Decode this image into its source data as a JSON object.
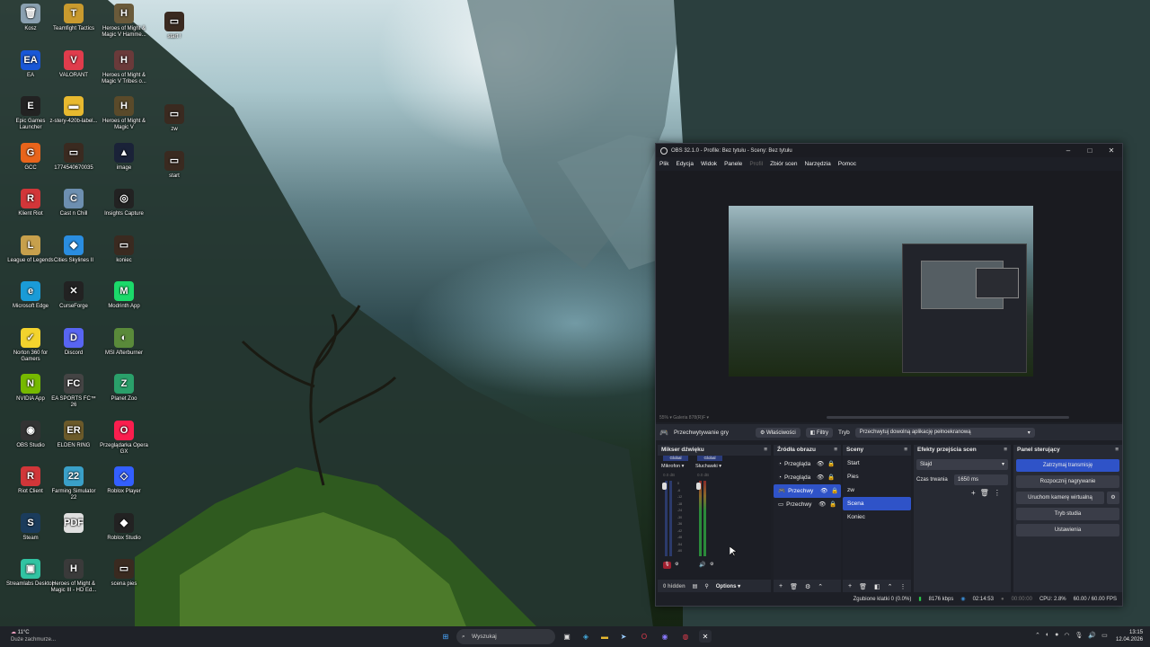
{
  "desktop_icons": [
    {
      "label": "Kosz",
      "icon": "recycle-bin-icon",
      "color": "#8aa0b0",
      "glyph": "🗑"
    },
    {
      "label": "EA",
      "icon": "ea-icon",
      "color": "#1957d6",
      "glyph": "EA"
    },
    {
      "label": "Epic Games Launcher",
      "icon": "epic-games-icon",
      "color": "#222",
      "glyph": "E"
    },
    {
      "label": "GCC",
      "icon": "gcc-icon",
      "color": "#e8641b",
      "glyph": "G"
    },
    {
      "label": "Klient Riot",
      "icon": "riot-icon",
      "color": "#d13639",
      "glyph": "R"
    },
    {
      "label": "League of Legends",
      "icon": "league-icon",
      "color": "#c7a04c",
      "glyph": "L"
    },
    {
      "label": "Microsoft Edge",
      "icon": "edge-icon",
      "color": "#1a9bd7",
      "glyph": "e"
    },
    {
      "label": "Norton 360 for Gamers",
      "icon": "norton-icon",
      "color": "#f3d32d",
      "glyph": "✓"
    },
    {
      "label": "NVIDIA App",
      "icon": "nvidia-icon",
      "color": "#76b900",
      "glyph": "N"
    },
    {
      "label": "OBS Studio",
      "icon": "obs-icon",
      "color": "#333",
      "glyph": "◉"
    },
    {
      "label": "Riot Client",
      "icon": "riot-client-icon",
      "color": "#d13639",
      "glyph": "R"
    },
    {
      "label": "Steam",
      "icon": "steam-icon",
      "color": "#1b3c5c",
      "glyph": "S"
    },
    {
      "label": "Streamlabs Desktop",
      "icon": "streamlabs-icon",
      "color": "#31c3a2",
      "glyph": "▣"
    },
    {
      "label": "Teamfight Tactics",
      "icon": "tft-icon",
      "color": "#c99a2e",
      "glyph": "T"
    },
    {
      "label": "VALORANT",
      "icon": "valorant-icon",
      "color": "#e03c4c",
      "glyph": "V"
    },
    {
      "label": "z-stery-420b-label...",
      "icon": "folder-icon",
      "color": "#e8b92f",
      "glyph": "▬"
    },
    {
      "label": "1774540670035",
      "icon": "video-file-icon",
      "color": "#3a2a20",
      "glyph": "▭"
    },
    {
      "label": "Cast n Chill",
      "icon": "cast-n-chill-icon",
      "color": "#6d8fb0",
      "glyph": "C"
    },
    {
      "label": "Cities Skylines II",
      "icon": "cities-icon",
      "color": "#2a8de0",
      "glyph": "◆"
    },
    {
      "label": "CurseForge",
      "icon": "curseforge-icon",
      "color": "#222",
      "glyph": "✕"
    },
    {
      "label": "Discord",
      "icon": "discord-icon",
      "color": "#5865f2",
      "glyph": "D"
    },
    {
      "label": "EA SPORTS FC™ 26",
      "icon": "easports-icon",
      "color": "#444",
      "glyph": "FC"
    },
    {
      "label": "ELDEN RING",
      "icon": "eldenring-icon",
      "color": "#6b5a2a",
      "glyph": "ER"
    },
    {
      "label": "Farming Simulator 22",
      "icon": "farming-icon",
      "color": "#3aa0c8",
      "glyph": "22"
    },
    {
      "label": "",
      "icon": "pdf-icon",
      "color": "#e0e0e0",
      "glyph": "PDF"
    },
    {
      "label": "Heroes of Might & Magic III - HD Ed...",
      "icon": "heroes3-icon",
      "color": "#3a3a3a",
      "glyph": "H"
    },
    {
      "label": "Heroes of Might & Magic V Hamme...",
      "icon": "heroes5-hammers-icon",
      "color": "#6a5a3a",
      "glyph": "H"
    },
    {
      "label": "Heroes of Might & Magic V Tribes o...",
      "icon": "heroes5-tribes-icon",
      "color": "#6a3a3a",
      "glyph": "H"
    },
    {
      "label": "Heroes of Might & Magic V",
      "icon": "heroes5-icon",
      "color": "#5a4a2a",
      "glyph": "H"
    },
    {
      "label": "image",
      "icon": "image-file-icon",
      "color": "#1a2238",
      "glyph": "▲"
    },
    {
      "label": "Insights Capture",
      "icon": "insights-icon",
      "color": "#222",
      "glyph": "◎"
    },
    {
      "label": "koniec",
      "icon": "video-file-icon",
      "color": "#3a2a20",
      "glyph": "▭"
    },
    {
      "label": "Modrinth App",
      "icon": "modrinth-icon",
      "color": "#1bd96a",
      "glyph": "M"
    },
    {
      "label": "MSI Afterburner",
      "icon": "msi-icon",
      "color": "#5a8a3a",
      "glyph": "◐"
    },
    {
      "label": "Planet Zoo",
      "icon": "planetzoo-icon",
      "color": "#2aa06a",
      "glyph": "Z"
    },
    {
      "label": "Przeglądarka Opera GX",
      "icon": "operagx-icon",
      "color": "#fa1e4e",
      "glyph": "O"
    },
    {
      "label": "Roblox Player",
      "icon": "roblox-icon",
      "color": "#335fff",
      "glyph": "◇"
    },
    {
      "label": "Roblox Studio",
      "icon": "roblox-studio-icon",
      "color": "#222",
      "glyph": "◆"
    },
    {
      "label": "scena pies",
      "icon": "video-file-icon",
      "color": "#3a2a20",
      "glyph": "▭"
    },
    {
      "label": "start !",
      "icon": "video-file-icon",
      "color": "#3a2a20",
      "glyph": "▭"
    },
    {
      "label": "zw",
      "icon": "video-file-icon",
      "color": "#3a2a20",
      "glyph": "▭"
    },
    {
      "label": "start",
      "icon": "video-file-icon",
      "color": "#3a2a20",
      "glyph": "▭"
    }
  ],
  "obs": {
    "title": "OBS 32.1.0 - Profile: Bez tytułu - Sceny: Bez tytułu",
    "menu": [
      "Plik",
      "Edycja",
      "Widok",
      "Panele",
      "Profil",
      "Zbiór scen",
      "Narzędzia",
      "Pomoc"
    ],
    "preview_scroll_text": "55% ▾   Galeria 878(R)F ▾",
    "source_bar": {
      "source_name": "Przechwytywanie gry",
      "properties": "Właściwości",
      "filters": "Filtry",
      "mode_label": "Tryb",
      "mode_value": "Przechwytuj dowolną aplikację pełnoekranową"
    },
    "mixer": {
      "title": "Mikser dźwięku",
      "ch1_tag": "Global",
      "ch1_name": "Mikrofon",
      "ch1_db": "0.0 dB",
      "ch2_tag": "Global",
      "ch2_name": "Słuchawki",
      "ch2_db": "0.0 dB",
      "scale": [
        "0",
        "-6",
        "-12",
        "-18",
        "-24",
        "-30",
        "-36",
        "-42",
        "-48",
        "-54",
        "-60"
      ],
      "hidden": "0 hidden",
      "options": "Options"
    },
    "sources": {
      "title": "Źródła obrazu",
      "items": [
        "Przegląda",
        "Przegląda",
        "Przechwy",
        "Przechwy"
      ]
    },
    "scenes": {
      "title": "Sceny",
      "items": [
        "Start",
        "Pies",
        "zw",
        "Scena",
        "Koniec"
      ]
    },
    "transitions": {
      "title": "Efekty przejścia scen",
      "type": "Slajd",
      "duration_label": "Czas trwania",
      "duration": "1650 ms"
    },
    "controls": {
      "title": "Panel sterujący",
      "buttons": [
        "Zatrzymaj transmisję",
        "Rozpocznij nagrywanie",
        "Uruchom kamerę wirtualną",
        "Tryb studia",
        "Ustawienia"
      ]
    },
    "status": {
      "dropped": "Zgubione klatki 0 (0.0%)",
      "bitrate": "8176 kbps",
      "stream_time": "02:14:53",
      "rec_time": "00:00:00",
      "cpu": "CPU: 2.8%",
      "fps": "60.00 / 60.00 FPS"
    }
  },
  "taskbar": {
    "weather_temp": "11°C",
    "weather_text": "Duże zachmurze...",
    "search": "Wyszukaj",
    "time": "13:15",
    "date": "12.04.2026"
  }
}
